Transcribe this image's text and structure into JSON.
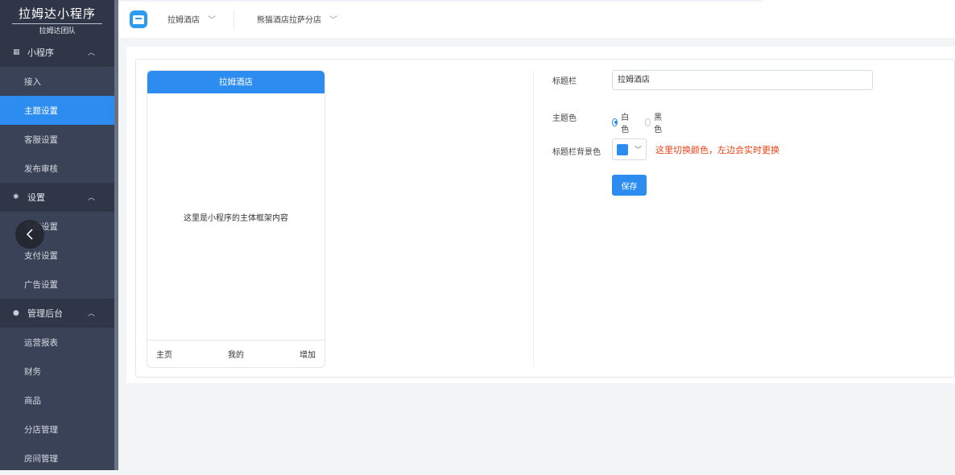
{
  "sidebar": {
    "brand_title": "拉姆达小程序",
    "brand_subtitle": "拉姆达团队",
    "groups": [
      {
        "label": "小程序",
        "icon": "grid-icon",
        "items": [
          "接入",
          "主题设置",
          "客服设置",
          "发布审核"
        ]
      },
      {
        "label": "设置",
        "icon": "gear-icon",
        "items": [
          "系统设置",
          "支付设置",
          "广告设置"
        ]
      },
      {
        "label": "管理后台",
        "icon": "circle-icon",
        "items": [
          "运营报表",
          "财务",
          "商品",
          "分店管理",
          "房间管理"
        ]
      }
    ],
    "active_item": "主题设置"
  },
  "topbar": {
    "hotel_select": "拉姆酒店",
    "branch_select": "熊猫酒店拉萨分店"
  },
  "preview": {
    "title": "拉姆酒店",
    "body_text": "这里是小程序的主体框架内容",
    "tabs": [
      "主页",
      "我的",
      "增加"
    ]
  },
  "form": {
    "title_bar_label": "标题栏",
    "title_bar_value": "拉姆酒店",
    "theme_label": "主题色",
    "theme_options": [
      "白色",
      "黑色"
    ],
    "theme_selected": "白色",
    "bg_label": "标题栏背景色",
    "bg_color": "#2d8cf0",
    "hint": "这里切换颜色，左边会实时更换",
    "save_label": "保存"
  },
  "colors": {
    "accent": "#2d8cf0",
    "sidebar_bg": "#3a4257",
    "hint_red": "#ed3f14"
  }
}
